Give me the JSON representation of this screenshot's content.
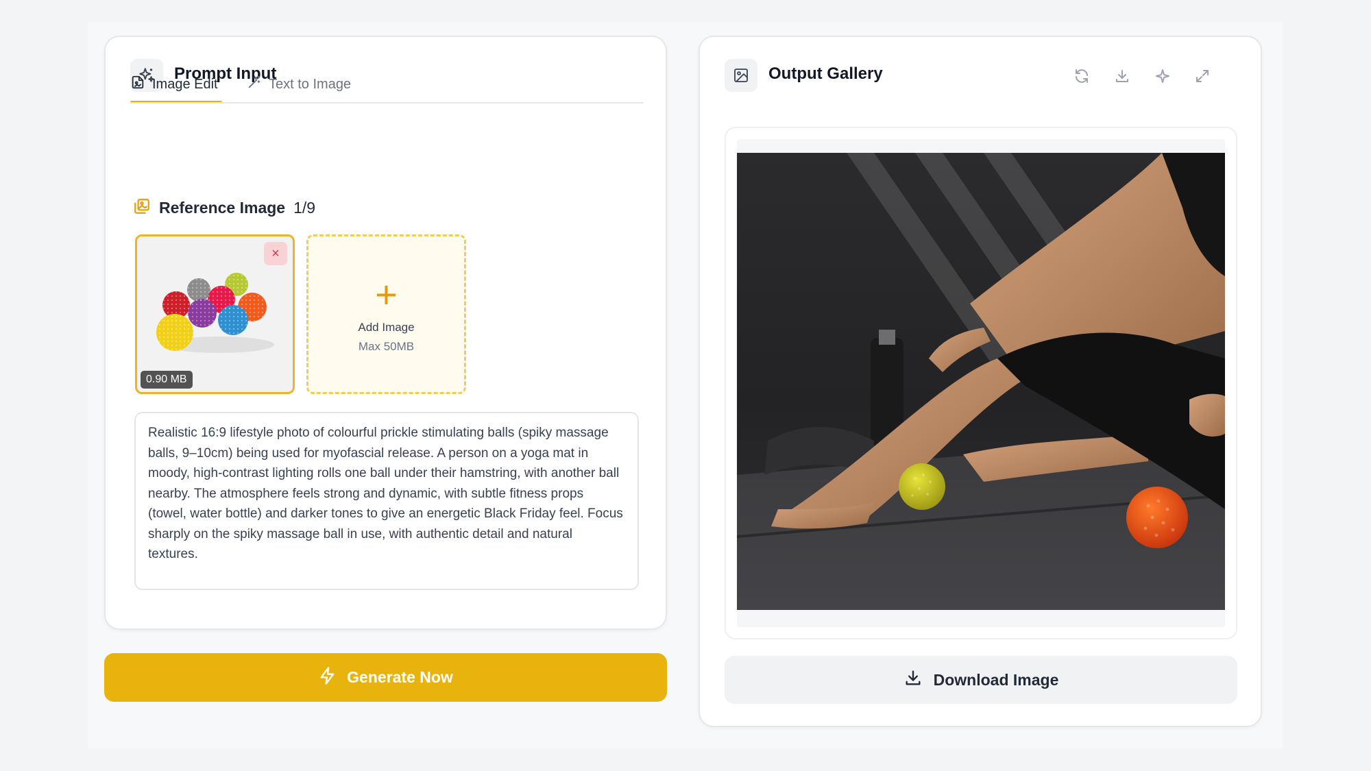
{
  "left_panel": {
    "title": "Prompt Input",
    "header_icon": "sparkles-icon",
    "tabs": [
      {
        "label": "Image Edit",
        "icon": "image-edit-icon",
        "active": true
      },
      {
        "label": "Text to Image",
        "icon": "magic-wand-icon",
        "active": false
      }
    ],
    "reference": {
      "title": "Reference Image",
      "count": "1/9",
      "icon": "image-gallery-icon",
      "thumbnail": {
        "size": "0.90 MB",
        "remove": "×"
      },
      "add": {
        "plus": "+",
        "label": "Add Image",
        "sub": "Max 50MB"
      }
    },
    "prompt": "Realistic 16:9 lifestyle photo of colourful prickle stimulating balls (spiky massage balls, 9–10cm) being used for myofascial release. A person on a yoga mat in moody, high-contrast lighting rolls one ball under their hamstring, with another ball nearby. The atmosphere feels strong and dynamic, with subtle fitness props (towel, water bottle) and darker tones to give an energetic Black Friday feel. Focus sharply on the spiky massage ball in use, with authentic detail and natural textures."
  },
  "generate_button": {
    "label": "Generate Now",
    "icon": "lightning-icon"
  },
  "right_panel": {
    "title": "Output Gallery",
    "header_icon": "image-icon",
    "toolbar": [
      "refresh-icon",
      "download-icon",
      "sparkle-icon",
      "expand-icon"
    ],
    "download_button": {
      "label": "Download Image",
      "icon": "download-icon"
    }
  },
  "colors": {
    "accent": "#e9b30d",
    "accent_dashed": "#f2cd55",
    "remove_bg": "#f9d2d6",
    "background": "#f3f4f6"
  }
}
